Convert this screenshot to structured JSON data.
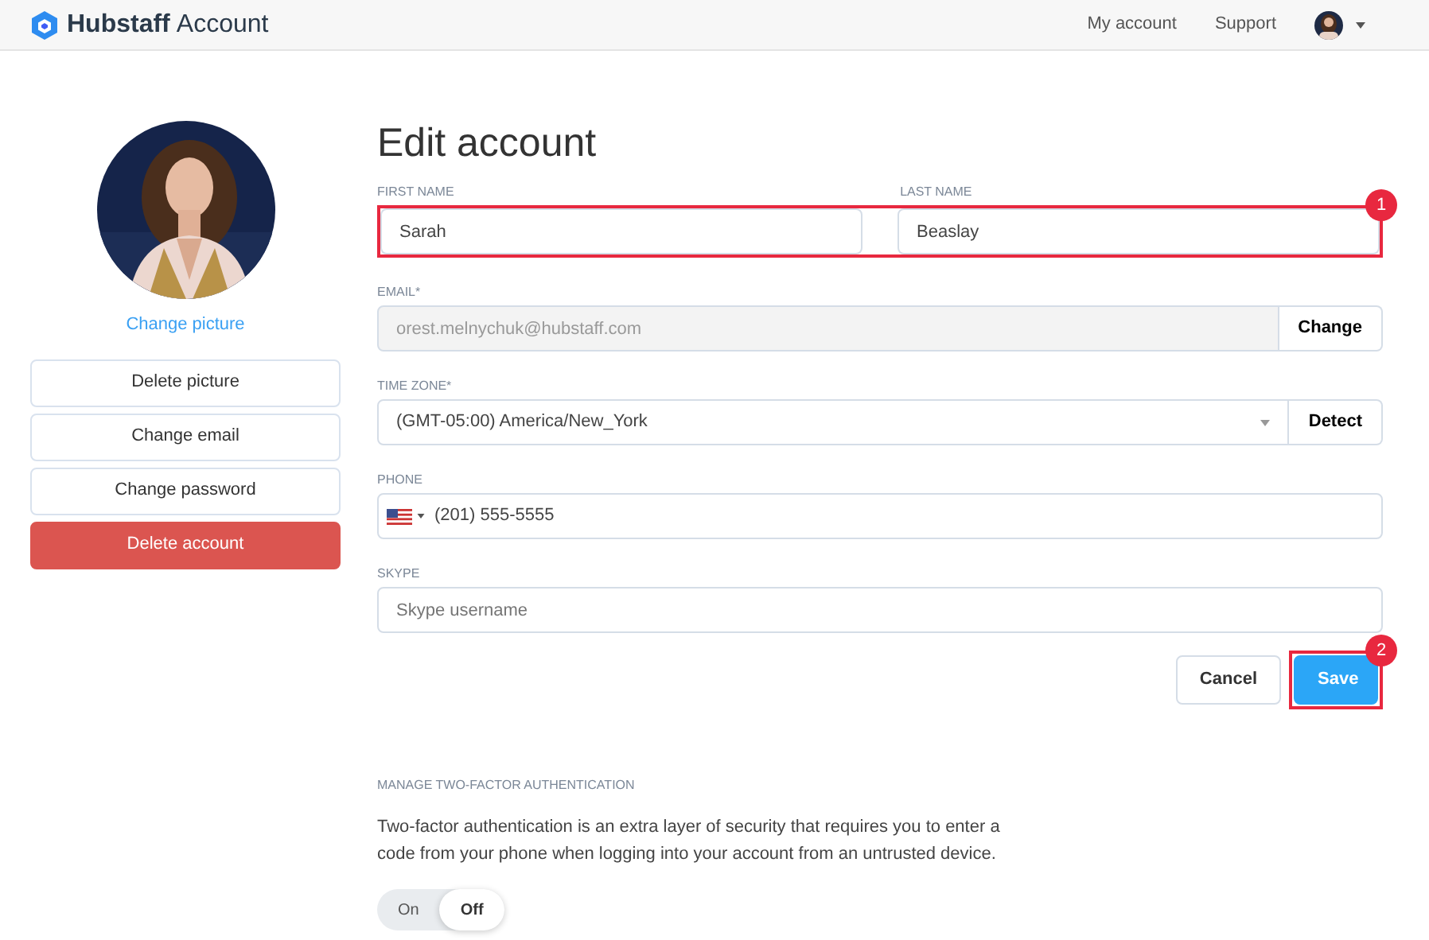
{
  "header": {
    "brand": "Hubstaff",
    "product": "Account",
    "links": [
      "My account",
      "Support"
    ]
  },
  "sidebar": {
    "change_picture": "Change picture",
    "buttons": [
      {
        "label": "Delete picture",
        "kind": "outline"
      },
      {
        "label": "Change email",
        "kind": "outline"
      },
      {
        "label": "Change password",
        "kind": "outline"
      },
      {
        "label": "Delete account",
        "kind": "danger"
      }
    ]
  },
  "form": {
    "title": "Edit account",
    "name_row": {
      "annotation": "1",
      "fields": [
        {
          "label": "FIRST NAME",
          "value": "Sarah"
        },
        {
          "label": "LAST NAME",
          "value": "Beaslay"
        }
      ]
    },
    "fields": [
      {
        "kind": "button",
        "label": "EMAIL*",
        "value": "orest.melnychuk@hubstaff.com",
        "disabled": true,
        "button": "Change"
      },
      {
        "kind": "select",
        "label": "TIME ZONE*",
        "value": "(GMT-05:00) America/New_York",
        "button": "Detect"
      },
      {
        "kind": "phone",
        "label": "PHONE",
        "value": "(201) 555-5555"
      },
      {
        "kind": "text",
        "label": "SKYPE",
        "placeholder": "Skype username"
      }
    ],
    "actions": [
      {
        "label": "Cancel",
        "kind": "secondary"
      },
      {
        "label": "Save",
        "kind": "primary",
        "annotation": "2"
      }
    ]
  },
  "two_factor": {
    "heading": "MANAGE TWO-FACTOR AUTHENTICATION",
    "text": "Two-factor authentication is an extra layer of security that requires you to enter a code from your phone when logging into your account from an untrusted device.",
    "options": [
      {
        "label": "On",
        "selected": false
      },
      {
        "label": "Off",
        "selected": true
      }
    ]
  }
}
